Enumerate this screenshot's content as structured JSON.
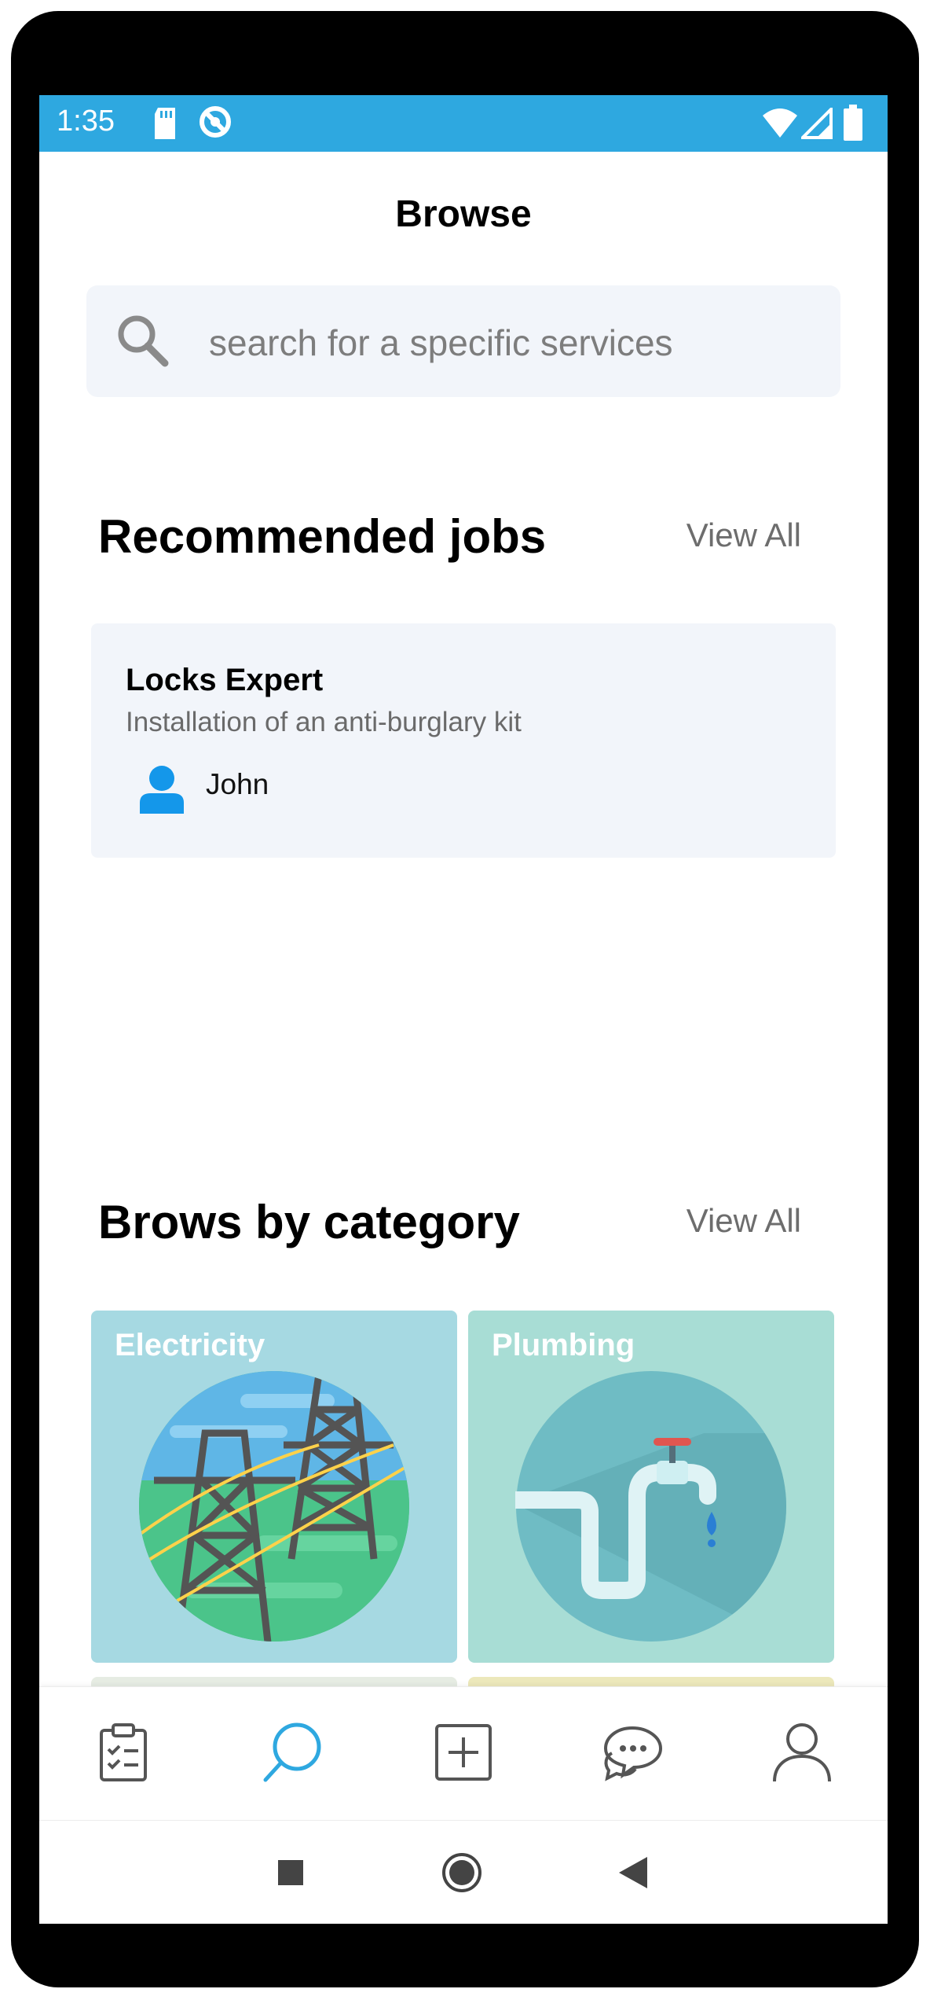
{
  "status_bar": {
    "time": "1:35",
    "background_color": "#2ea8e0",
    "left_icons": [
      "sd-card-icon",
      "sync-disabled-icon"
    ],
    "right_icons": [
      "wifi-icon",
      "signal-icon",
      "battery-icon"
    ]
  },
  "header": {
    "title": "Browse"
  },
  "search": {
    "placeholder": "search for a specific services"
  },
  "recommended": {
    "title": "Recommended jobs",
    "view_all": "View All",
    "jobs": [
      {
        "title": "Locks Expert",
        "description": "Installation of an anti-burglary kit",
        "user": "John"
      }
    ]
  },
  "categories": {
    "title": "Brows by category",
    "view_all": "View All",
    "items": [
      {
        "label": "Electricity",
        "icon": "power-lines-icon",
        "color": "#a6d9e2"
      },
      {
        "label": "Plumbing",
        "icon": "faucet-pipe-icon",
        "color": "#a8ddd5"
      }
    ]
  },
  "bottom_nav": {
    "active_color": "#2ea8e0",
    "items": [
      {
        "name": "tasks",
        "icon": "clipboard-checklist-icon",
        "active": false
      },
      {
        "name": "browse",
        "icon": "search-icon",
        "active": true
      },
      {
        "name": "add",
        "icon": "plus-square-icon",
        "active": false
      },
      {
        "name": "messages",
        "icon": "chat-bubbles-icon",
        "active": false
      },
      {
        "name": "profile",
        "icon": "person-icon",
        "active": false
      }
    ]
  },
  "system_nav": {
    "icons": [
      "recents-square-icon",
      "home-circle-icon",
      "back-triangle-icon"
    ]
  }
}
